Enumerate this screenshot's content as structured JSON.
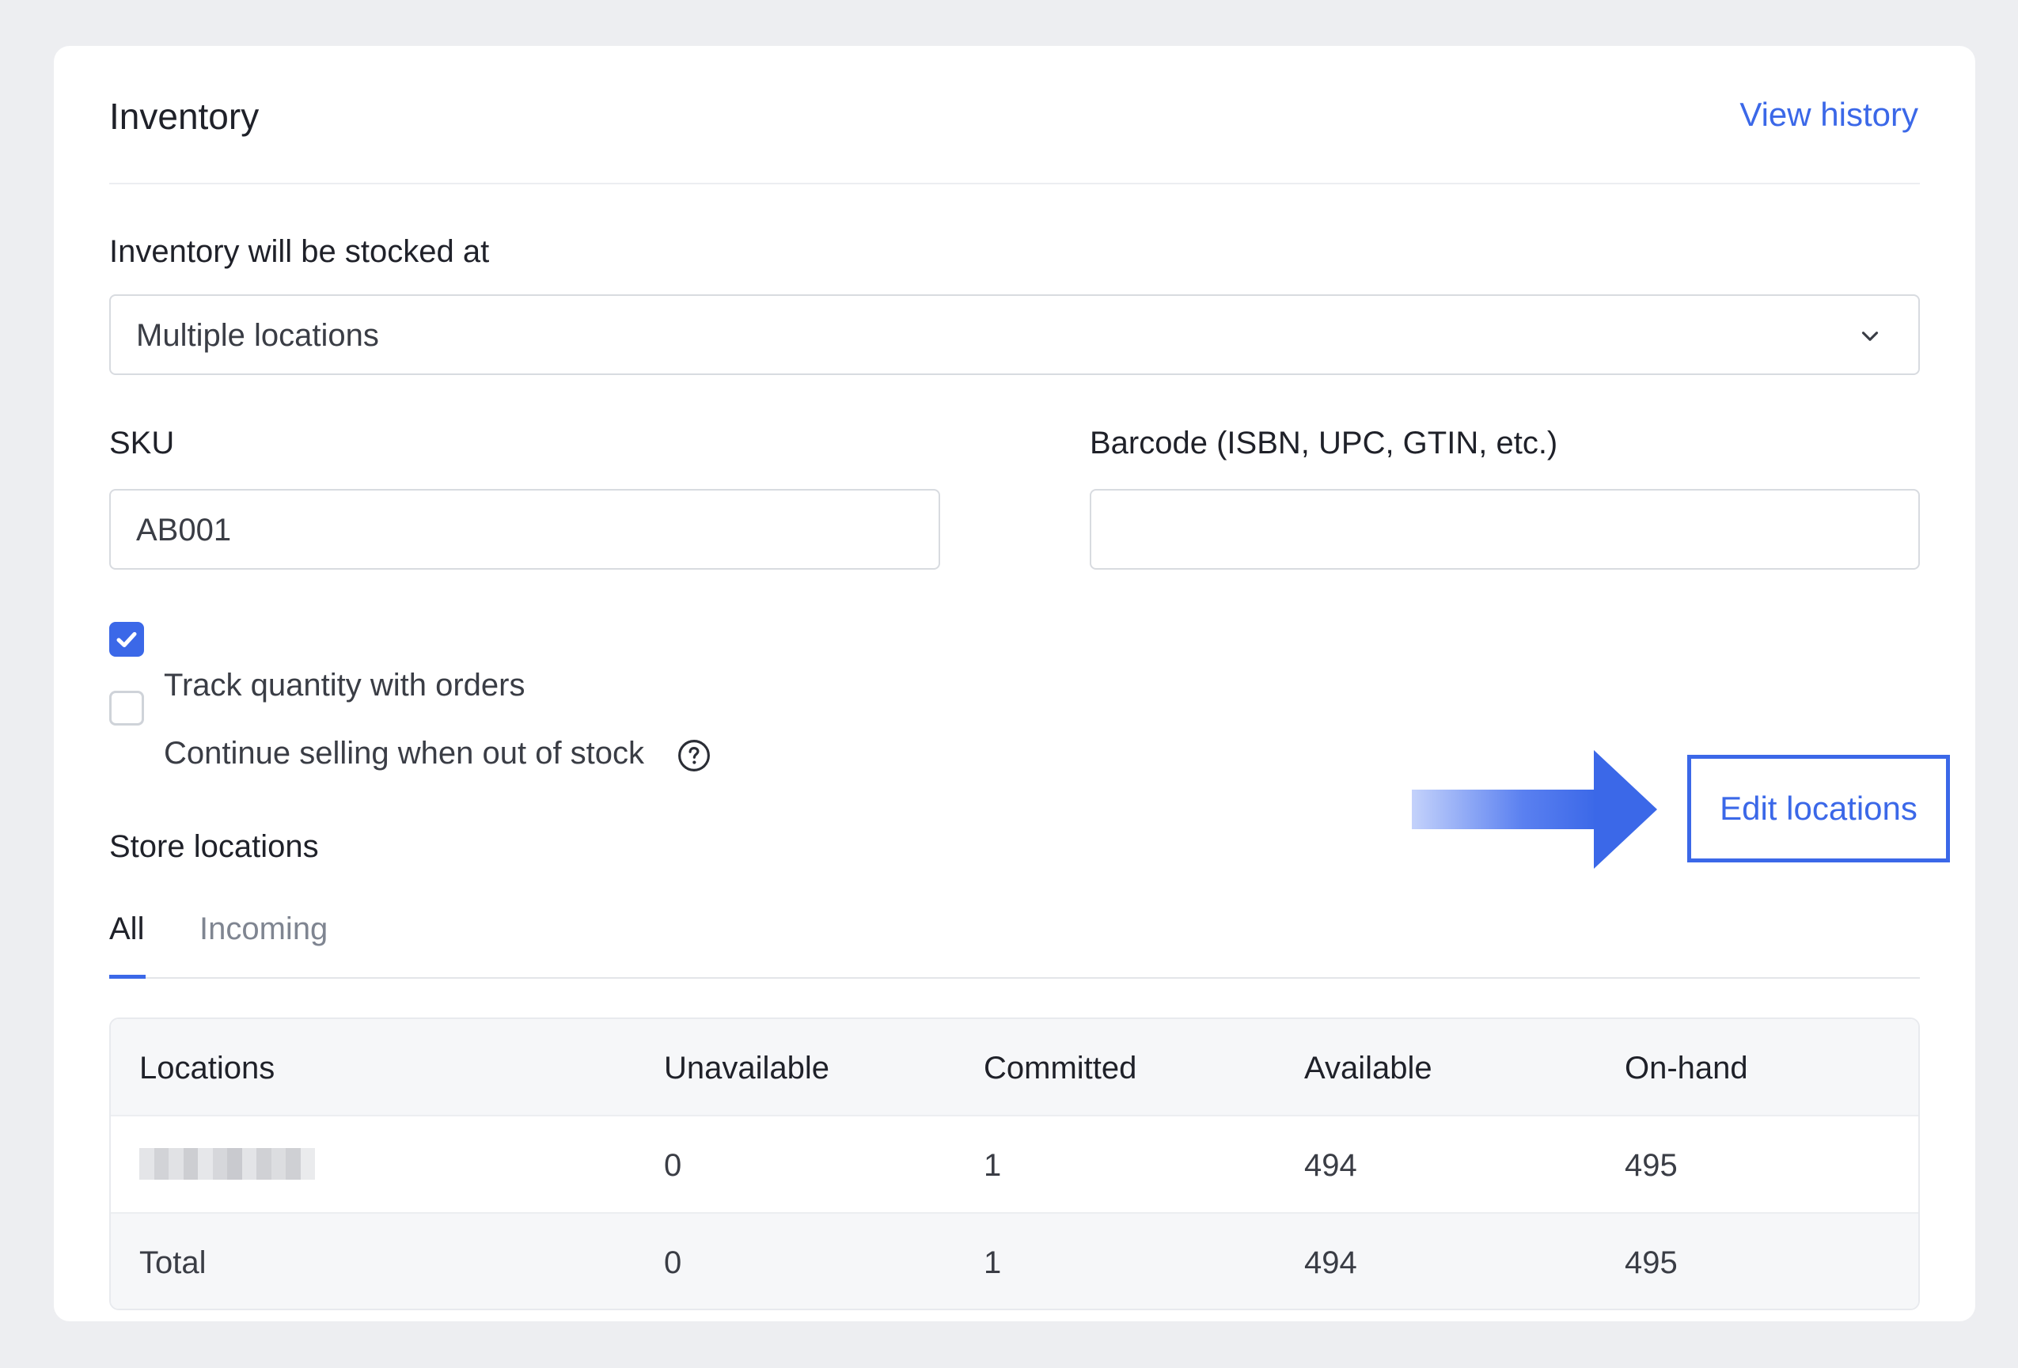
{
  "header": {
    "title": "Inventory",
    "view_history": "View history"
  },
  "stock": {
    "label": "Inventory will be stocked at",
    "selected": "Multiple locations"
  },
  "sku": {
    "label": "SKU",
    "value": "AB001"
  },
  "barcode": {
    "label": "Barcode (ISBN, UPC, GTIN, etc.)",
    "value": ""
  },
  "options": {
    "track_quantity": {
      "label": "Track quantity with orders",
      "checked": true
    },
    "continue_selling": {
      "label": "Continue selling when out of stock",
      "checked": false
    }
  },
  "store_locations": {
    "title": "Store locations",
    "edit_button": "Edit locations",
    "tabs": [
      {
        "label": "All",
        "active": true
      },
      {
        "label": "Incoming",
        "active": false
      }
    ],
    "table": {
      "headers": [
        "Locations",
        "Unavailable",
        "Committed",
        "Available",
        "On-hand"
      ],
      "rows": [
        {
          "location_redacted": true,
          "unavailable": "0",
          "committed": "1",
          "available": "494",
          "on_hand": "495"
        }
      ],
      "total": {
        "label": "Total",
        "unavailable": "0",
        "committed": "1",
        "available": "494",
        "on_hand": "495"
      }
    }
  },
  "colors": {
    "accent": "#3b68e8",
    "background": "#edeef1",
    "card": "#ffffff"
  },
  "icons": {
    "dropdown": "chevron-down-icon",
    "checkbox_checked": "checkmark-icon",
    "help": "question-circle-icon",
    "annotation": "arrow-right-icon"
  }
}
